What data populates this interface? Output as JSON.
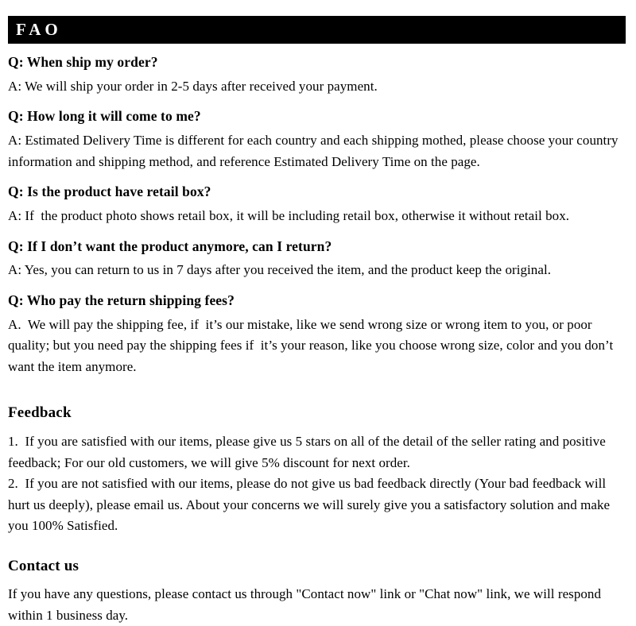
{
  "header": {
    "title": "FAO"
  },
  "faq": {
    "items": [
      {
        "question": "Q: When ship my order?",
        "answer": "A: We will ship your order in 2-5 days after received your payment."
      },
      {
        "question": "Q: How long it will come to me?",
        "answer": "A: Estimated Delivery Time is different for each country and each shipping mothed, please choose your country information and shipping method, and reference Estimated Delivery Time on the page."
      },
      {
        "question": "Q: Is the product have retail box?",
        "answer": "A: If  the product photo shows retail box, it will be including retail box, otherwise it without retail box."
      },
      {
        "question": "Q: If  I don’t want the product anymore, can I return?",
        "answer": "A: Yes, you can return to us in 7 days after you received the item, and the product keep the original."
      },
      {
        "question": "Q: Who pay the return shipping fees?",
        "answer": "A.  We will pay the shipping fee, if  it’s our mistake, like we send wrong size or wrong item to you, or poor quality; but you need pay the shipping fees if  it’s your reason, like you choose wrong size, color and you don’t want the item anymore."
      }
    ]
  },
  "feedback": {
    "heading": "Feedback",
    "paragraphs": [
      "1.  If you are satisfied with our items, please give us 5 stars on all of the detail of the seller rating and positive feedback; For our old customers, we will give 5% discount for next order.",
      "2.  If you are not satisfied with our items, please do not give us bad feedback directly (Your bad feedback will hurt us deeply), please email us. About your concerns we will surely give you a satisfactory solution and make you 100% Satisfied."
    ]
  },
  "contact": {
    "heading": "Contact us",
    "paragraph": "If you have any questions, please contact us through \"Contact now\" link or \"Chat now\" link, we will respond within 1 business day."
  },
  "colors": {
    "header_background": "#000000",
    "header_text": "#ffffff",
    "page_background": "#ffffff",
    "body_text": "#000000"
  }
}
